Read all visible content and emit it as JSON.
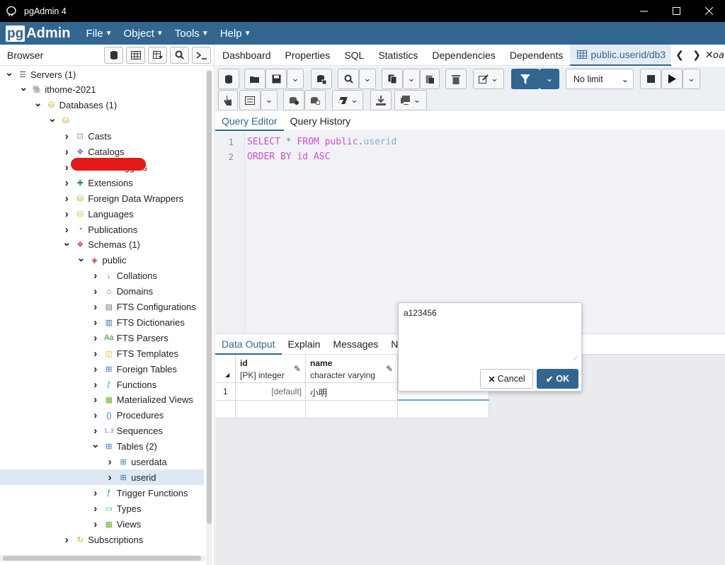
{
  "window": {
    "title": "pgAdmin 4"
  },
  "menubar": {
    "logo_pg": "pg",
    "logo_admin": "Admin",
    "items": [
      "File",
      "Object",
      "Tools",
      "Help"
    ]
  },
  "browser": {
    "title": "Browser",
    "tree": [
      {
        "label": "Servers (1)",
        "level": 0,
        "chev": "open",
        "icon": "servers-icon"
      },
      {
        "label": "ithome-2021",
        "level": 1,
        "chev": "open",
        "icon": "elephant-icon"
      },
      {
        "label": "Databases (1)",
        "level": 2,
        "chev": "open",
        "icon": "databases-icon"
      },
      {
        "label": "",
        "level": 3,
        "chev": "open",
        "icon": "database-icon"
      },
      {
        "label": "Casts",
        "level": 4,
        "chev": "closed",
        "icon": "casts-icon"
      },
      {
        "label": "Catalogs",
        "level": 4,
        "chev": "closed",
        "icon": "catalogs-icon"
      },
      {
        "label": "Event Triggers",
        "level": 4,
        "chev": "closed",
        "icon": "event-triggers-icon"
      },
      {
        "label": "Extensions",
        "level": 4,
        "chev": "closed",
        "icon": "extensions-icon"
      },
      {
        "label": "Foreign Data Wrappers",
        "level": 4,
        "chev": "closed",
        "icon": "foreign-data-wrappers-icon"
      },
      {
        "label": "Languages",
        "level": 4,
        "chev": "closed",
        "icon": "languages-icon"
      },
      {
        "label": "Publications",
        "level": 4,
        "chev": "closed",
        "icon": "publications-icon"
      },
      {
        "label": "Schemas (1)",
        "level": 4,
        "chev": "open",
        "icon": "schemas-icon"
      },
      {
        "label": "public",
        "level": 5,
        "chev": "open",
        "icon": "schema-icon"
      },
      {
        "label": "Collations",
        "level": 6,
        "chev": "closed",
        "icon": "collations-icon"
      },
      {
        "label": "Domains",
        "level": 6,
        "chev": "closed",
        "icon": "domains-icon"
      },
      {
        "label": "FTS Configurations",
        "level": 6,
        "chev": "closed",
        "icon": "fts-configurations-icon"
      },
      {
        "label": "FTS Dictionaries",
        "level": 6,
        "chev": "closed",
        "icon": "fts-dictionaries-icon"
      },
      {
        "label": "FTS Parsers",
        "level": 6,
        "chev": "closed",
        "icon": "fts-parsers-icon"
      },
      {
        "label": "FTS Templates",
        "level": 6,
        "chev": "closed",
        "icon": "fts-templates-icon"
      },
      {
        "label": "Foreign Tables",
        "level": 6,
        "chev": "closed",
        "icon": "foreign-tables-icon"
      },
      {
        "label": "Functions",
        "level": 6,
        "chev": "closed",
        "icon": "functions-icon"
      },
      {
        "label": "Materialized Views",
        "level": 6,
        "chev": "closed",
        "icon": "materialized-views-icon"
      },
      {
        "label": "Procedures",
        "level": 6,
        "chev": "closed",
        "icon": "procedures-icon"
      },
      {
        "label": "Sequences",
        "level": 6,
        "chev": "closed",
        "icon": "sequences-icon"
      },
      {
        "label": "Tables (2)",
        "level": 6,
        "chev": "open",
        "icon": "tables-icon"
      },
      {
        "label": "userdata",
        "level": 7,
        "chev": "closed",
        "icon": "table-icon"
      },
      {
        "label": "userid",
        "level": 7,
        "chev": "closed",
        "icon": "table-icon",
        "selected": true
      },
      {
        "label": "Trigger Functions",
        "level": 6,
        "chev": "closed",
        "icon": "trigger-functions-icon"
      },
      {
        "label": "Types",
        "level": 6,
        "chev": "closed",
        "icon": "types-icon"
      },
      {
        "label": "Views",
        "level": 6,
        "chev": "closed",
        "icon": "views-icon"
      },
      {
        "label": "Subscriptions",
        "level": 4,
        "chev": "closed",
        "icon": "subscriptions-icon"
      }
    ]
  },
  "main": {
    "tabs": [
      "Dashboard",
      "Properties",
      "SQL",
      "Statistics",
      "Dependencies",
      "Dependents"
    ],
    "active_tab": "public.userid/db3",
    "next_tab_fragment": "oa",
    "limit_select": "No limit",
    "subtabs": [
      "Query Editor",
      "Query History"
    ],
    "editor": {
      "line_numbers": [
        "1",
        "2"
      ],
      "line1": {
        "kw1": "SELECT",
        "star": "*",
        "kw2": "FROM",
        "schema": "public",
        "dot": ".",
        "table": "userid"
      },
      "line2": {
        "kw1": "ORDER BY",
        "col": "id",
        "kw2": "ASC"
      }
    },
    "result_tabs": [
      "Data Output",
      "Explain",
      "Messages",
      "N"
    ],
    "grid": {
      "columns": [
        {
          "name": "id",
          "type": "[PK] integer"
        },
        {
          "name": "name",
          "type": "character varying"
        }
      ],
      "rows": [
        {
          "num": "1",
          "id": "[default]",
          "name": "小明"
        }
      ]
    },
    "popup": {
      "value": "a123456",
      "cancel_label": "Cancel",
      "ok_label": "OK"
    }
  },
  "colors": {
    "brand": "#326690",
    "keyword": "#d14fd1",
    "redaction": "#e31919"
  }
}
